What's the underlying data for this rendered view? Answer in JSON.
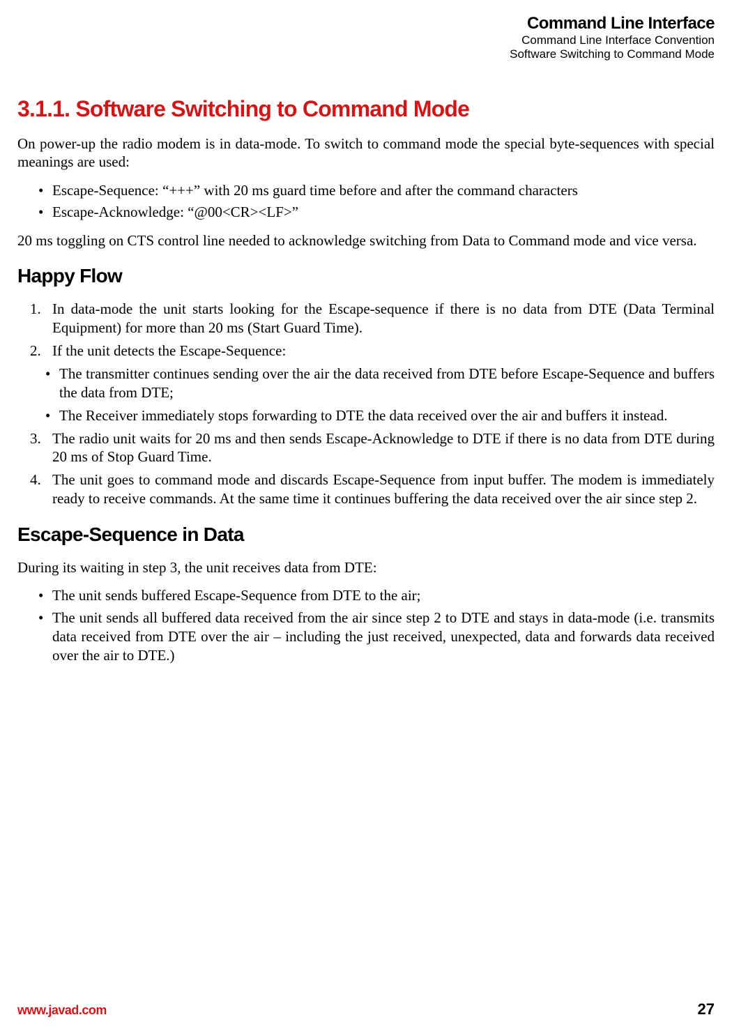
{
  "header": {
    "title": "Command Line Interface",
    "sub1": "Command Line Interface Convention",
    "sub2": "Software Switching to Command Mode"
  },
  "section": {
    "number_title": "3.1.1. Software Switching to Command Mode",
    "intro": "On power-up the radio modem is in data-mode. To switch to command mode the special byte-sequences with special meanings are used:",
    "escape_bullets": [
      "Escape-Sequence: “+++” with 20 ms guard time before and after the command characters",
      "Escape-Acknowledge: “@00<CR><LF>”"
    ],
    "cts_note": "20 ms toggling on CTS control line needed to acknowledge switching from Data to Command mode and vice versa."
  },
  "happy_flow": {
    "title": "Happy Flow",
    "items": [
      {
        "text": "In data-mode the unit starts looking for the Escape-sequence if there is no data from DTE (Data Terminal Equipment) for more than 20 ms (Start Guard Time)."
      },
      {
        "text": "If the unit detects the Escape-Sequence:",
        "sub": [
          "The transmitter continues sending over the air the data received from DTE before Escape-Sequence and buffers the data from DTE;",
          "The Receiver immediately stops forwarding to DTE the data received over the air and buffers it instead."
        ]
      },
      {
        "text": "The radio unit waits for 20 ms and then sends Escape-Acknowledge to DTE if there is no data from DTE during 20 ms of Stop Guard Time."
      },
      {
        "text": "The unit goes to command mode and discards Escape-Sequence from input buffer. The modem is immediately ready to receive commands. At the same time it continues buffering the data received over the air since step 2."
      }
    ]
  },
  "escape_in_data": {
    "title": "Escape-Sequence in Data",
    "intro": "During its waiting in step 3, the unit receives data from DTE:",
    "bullets": [
      "The unit sends buffered Escape-Sequence from DTE to the air;",
      "The unit sends all buffered data received from the air since step 2 to DTE and stays in data-mode (i.e. transmits data received from DTE over the air – including the just received, unexpected, data and forwards data received over the air to DTE.)"
    ]
  },
  "footer": {
    "url": "www.javad.com",
    "page": "27"
  }
}
